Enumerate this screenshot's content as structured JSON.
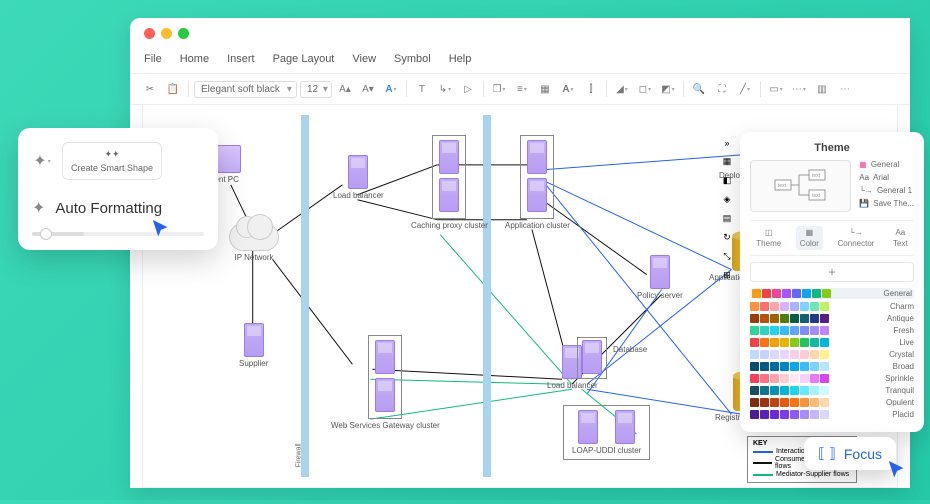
{
  "menus": [
    "File",
    "Home",
    "Insert",
    "Page Layout",
    "View",
    "Symbol",
    "Help"
  ],
  "toolbar": {
    "font": "Elegant soft black",
    "size": "12"
  },
  "panel": {
    "smart": "Create Smart Shape",
    "auto": "Auto Formatting"
  },
  "focus": {
    "label": "Focus"
  },
  "nodes": {
    "client": "Client PC",
    "ip": "IP Network",
    "supplier": "Supplier",
    "firewall": "Firewall",
    "lb1": "Load balancer",
    "cache": "Caching proxy cluster",
    "ws": "Web Services Gateway cluster",
    "app": "Application cluster",
    "lb2": "Load balancer",
    "db": "Database",
    "loap": "LOAP-UDDI cluster",
    "deploy": "Deployment manager",
    "policy": "Policy server",
    "appdb": "Application database",
    "regdb": "Registry database"
  },
  "key": {
    "title": "KEY",
    "r1": "Interactions",
    "r2": "Consumer-Mediator flows",
    "r3": "Mediator-Supplier flows"
  },
  "theme": {
    "title": "Theme",
    "opts": [
      "General",
      "Arial",
      "General 1",
      "Save The..."
    ],
    "tabs": [
      "Theme",
      "Color",
      "Connector",
      "Text"
    ],
    "palettes": [
      "General",
      "Charm",
      "Antique",
      "Fresh",
      "Live",
      "Crystal",
      "Broad",
      "Sprinkle",
      "Tranquil",
      "Opulent",
      "Placid"
    ]
  },
  "swatches": [
    [
      "#f59e0b",
      "#ef4444",
      "#ec4899",
      "#a855f7",
      "#6366f1",
      "#0ea5e9",
      "#10b981",
      "#84cc16"
    ],
    [
      "#fb923c",
      "#f87171",
      "#fda4af",
      "#d8b4fe",
      "#a5b4fc",
      "#7dd3fc",
      "#6ee7b7",
      "#bef264"
    ],
    [
      "#92400e",
      "#b45309",
      "#a16207",
      "#4d7c0f",
      "#065f46",
      "#155e75",
      "#1e3a8a",
      "#581c87"
    ],
    [
      "#34d399",
      "#2dd4bf",
      "#22d3ee",
      "#38bdf8",
      "#60a5fa",
      "#818cf8",
      "#a78bfa",
      "#c084fc"
    ],
    [
      "#ef4444",
      "#f97316",
      "#f59e0b",
      "#eab308",
      "#84cc16",
      "#22c55e",
      "#14b8a6",
      "#06b6d4"
    ],
    [
      "#bfdbfe",
      "#c7d2fe",
      "#ddd6fe",
      "#e9d5ff",
      "#fbcfe8",
      "#fecdd3",
      "#fed7aa",
      "#fef08a"
    ],
    [
      "#0c4a6e",
      "#075985",
      "#0369a1",
      "#0284c7",
      "#0ea5e9",
      "#38bdf8",
      "#7dd3fc",
      "#bae6fd"
    ],
    [
      "#f43f5e",
      "#fb7185",
      "#fda4af",
      "#fecdd3",
      "#fce7f3",
      "#f5d0fe",
      "#e879f9",
      "#d946ef"
    ],
    [
      "#164e63",
      "#0e7490",
      "#0891b2",
      "#06b6d4",
      "#22d3ee",
      "#67e8f9",
      "#a5f3fc",
      "#cffafe"
    ],
    [
      "#7c2d12",
      "#9a3412",
      "#c2410c",
      "#ea580c",
      "#f97316",
      "#fb923c",
      "#fdba74",
      "#fed7aa"
    ],
    [
      "#4c1d95",
      "#5b21b6",
      "#6d28d9",
      "#7c3aed",
      "#8b5cf6",
      "#a78bfa",
      "#c4b5fd",
      "#ddd6fe"
    ]
  ]
}
